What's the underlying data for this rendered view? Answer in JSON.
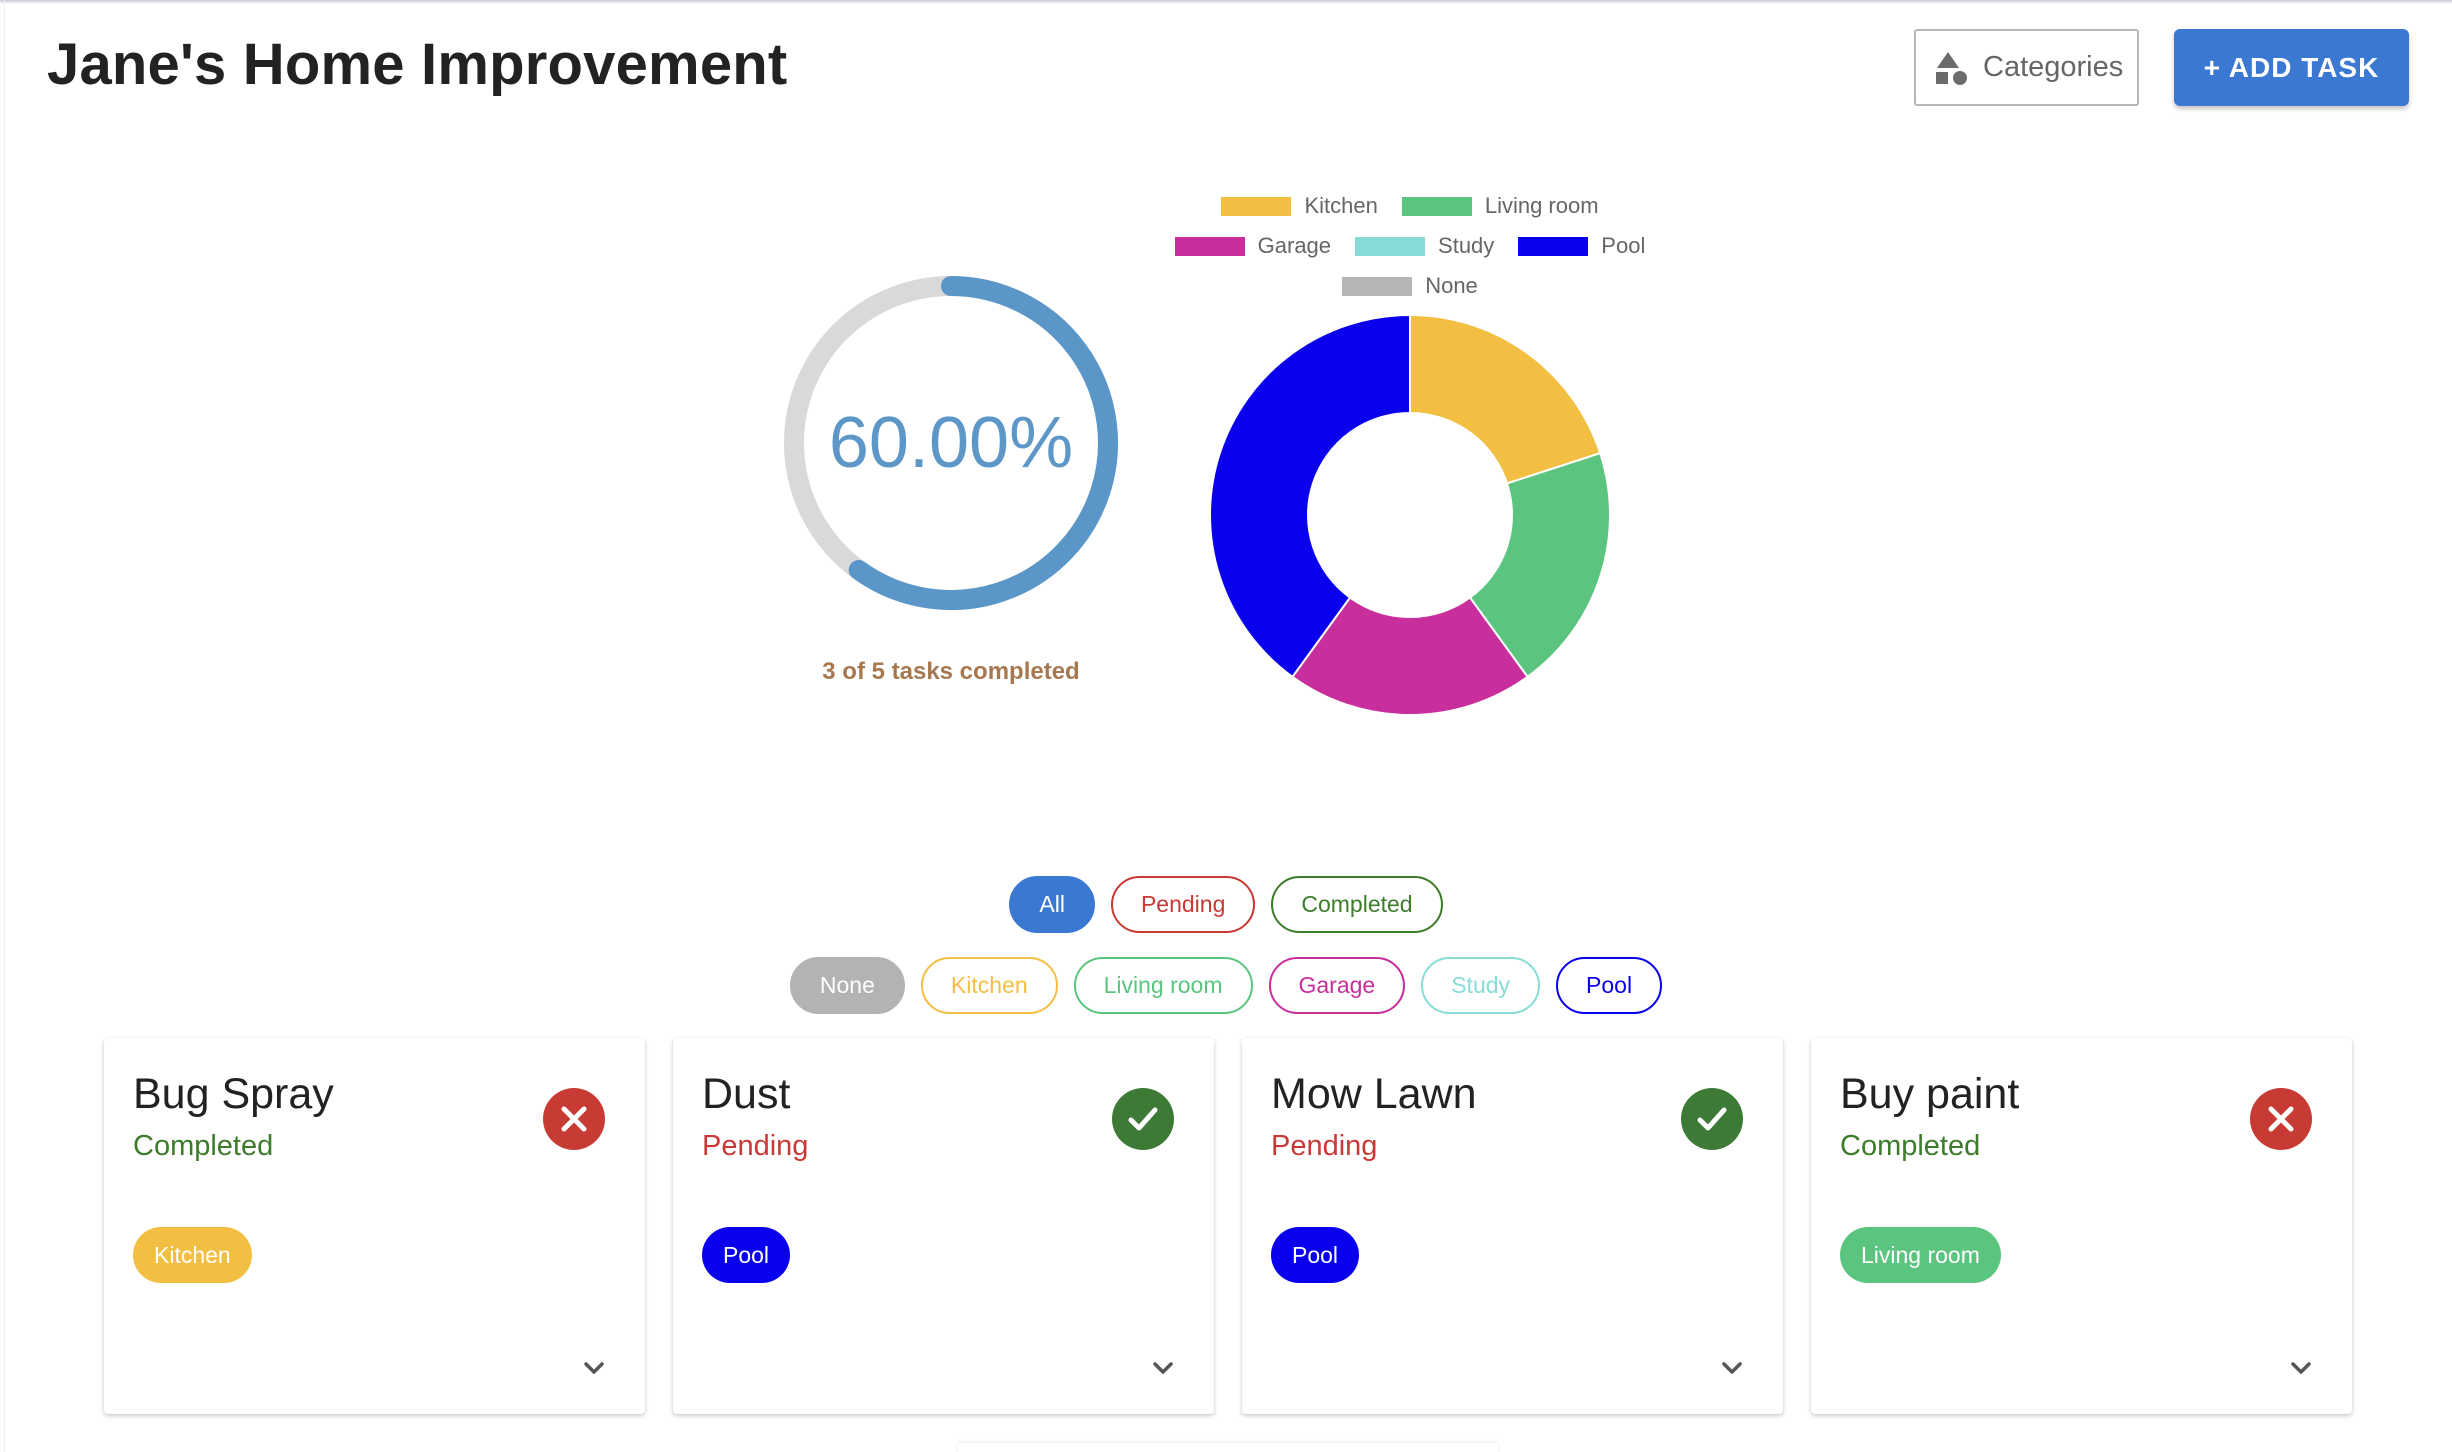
{
  "header": {
    "title": "Jane's Home Improvement",
    "categories_label": "Categories",
    "categories_icon": "shapes-icon",
    "add_task_label": "+ ADD TASK"
  },
  "progress": {
    "percent_label": "60.00%",
    "fraction": 0.6,
    "caption": "3 of 5 tasks completed",
    "track_color": "#d9d9d9",
    "fill_color": "#5a97c8"
  },
  "chart_data": {
    "type": "pie",
    "donut": true,
    "legend_position": "top",
    "categories": [
      "Kitchen",
      "Living room",
      "Garage",
      "Study",
      "Pool",
      "None"
    ],
    "values": [
      1,
      1,
      1,
      0,
      2,
      0
    ],
    "colors": [
      "#f3bf42",
      "#5bc47f",
      "#c82f9c",
      "#88dcd8",
      "#0a00ed",
      "#b7b4b4"
    ]
  },
  "filters": {
    "status": [
      {
        "label": "All",
        "color": "#3a78d2",
        "active": true
      },
      {
        "label": "Pending",
        "color": "#c93935",
        "active": false
      },
      {
        "label": "Completed",
        "color": "#3d7c2b",
        "active": false
      }
    ],
    "categories": [
      {
        "label": "None",
        "color": "#b5b2b2",
        "active": true
      },
      {
        "label": "Kitchen",
        "color": "#f3bf42",
        "active": false
      },
      {
        "label": "Living room",
        "color": "#5bc47f",
        "active": false
      },
      {
        "label": "Garage",
        "color": "#c82f9c",
        "active": false
      },
      {
        "label": "Study",
        "color": "#88dcd8",
        "active": false
      },
      {
        "label": "Pool",
        "color": "#0a00ed",
        "active": false
      }
    ]
  },
  "tasks": [
    {
      "title": "Bug Spray",
      "status": "Completed",
      "status_color": "#3d7c2b",
      "action_icon": "close-icon",
      "action_color": "#c83b34",
      "category": "Kitchen",
      "category_color": "#f3bf42"
    },
    {
      "title": "Dust",
      "status": "Pending",
      "status_color": "#c93935",
      "action_icon": "check-icon",
      "action_color": "#3c7a36",
      "category": "Pool",
      "category_color": "#0a00ed"
    },
    {
      "title": "Mow Lawn",
      "status": "Pending",
      "status_color": "#c93935",
      "action_icon": "check-icon",
      "action_color": "#3c7a36",
      "category": "Pool",
      "category_color": "#0a00ed"
    },
    {
      "title": "Buy paint",
      "status": "Completed",
      "status_color": "#3d7c2b",
      "action_icon": "close-icon",
      "action_color": "#c83b34",
      "category": "Living room",
      "category_color": "#5bc47f"
    }
  ]
}
